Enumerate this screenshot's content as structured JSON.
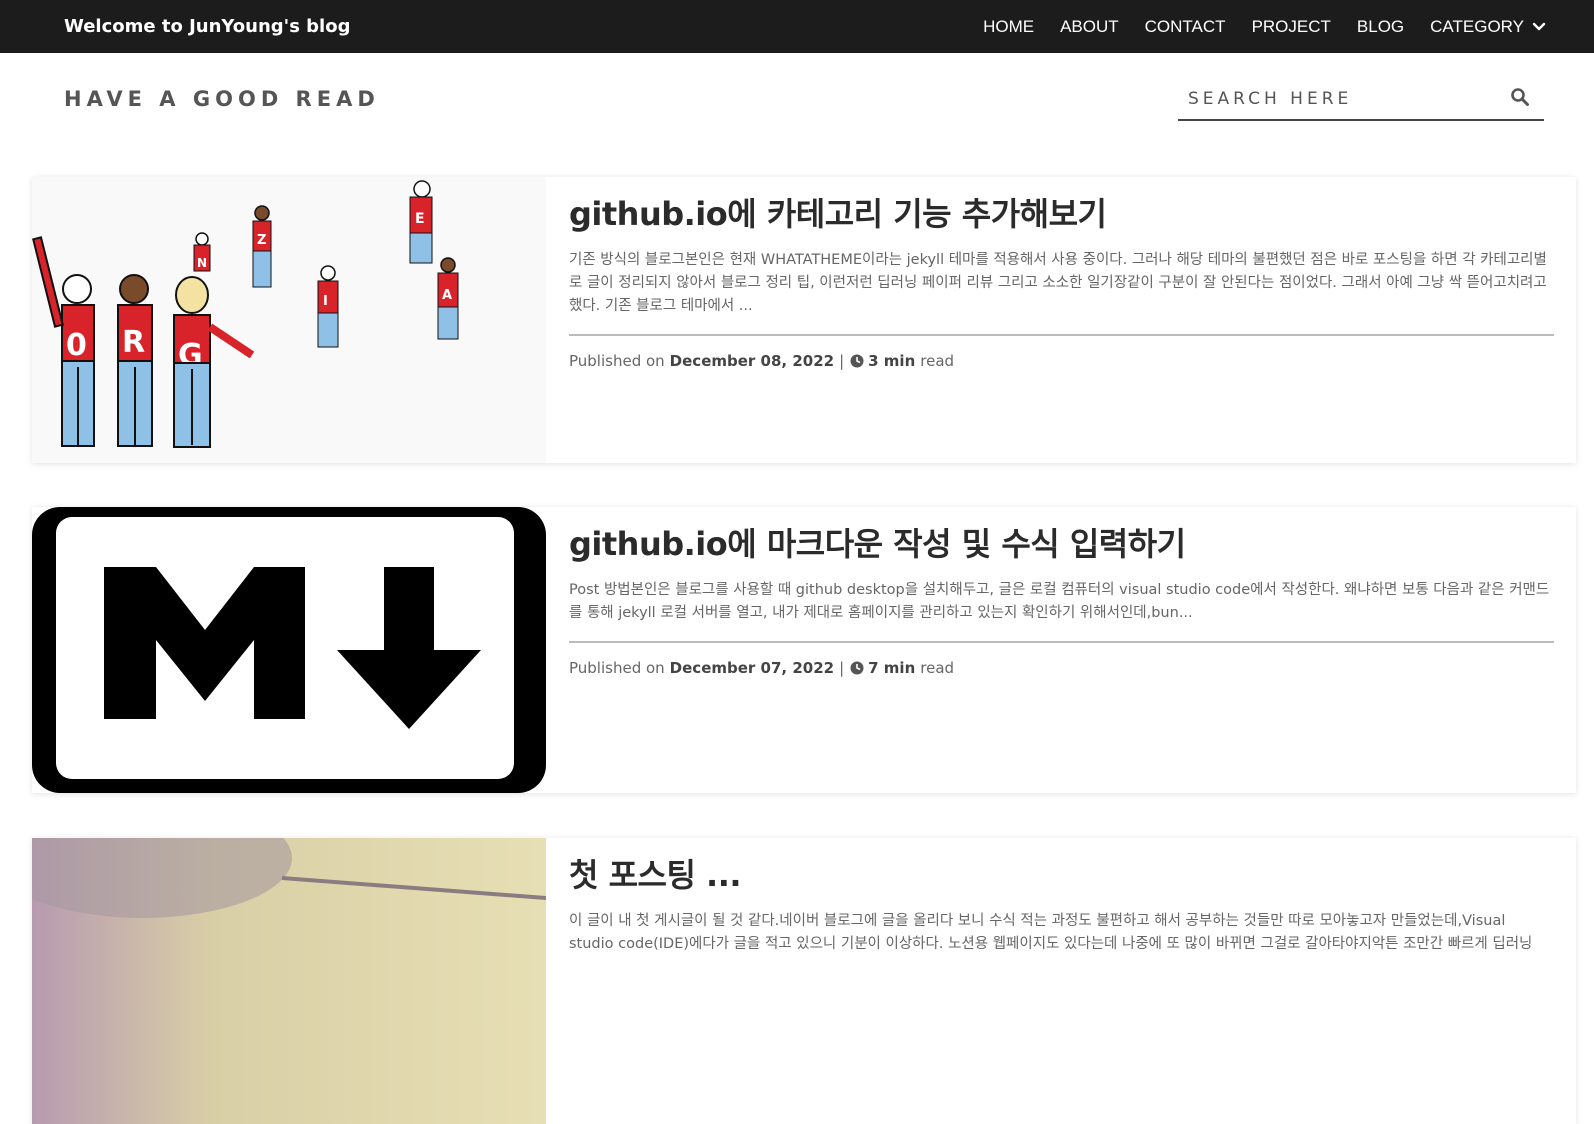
{
  "header": {
    "site_title": "Welcome to JunYoung's blog",
    "nav": [
      {
        "label": "HOME"
      },
      {
        "label": "ABOUT"
      },
      {
        "label": "CONTACT"
      },
      {
        "label": "PROJECT"
      },
      {
        "label": "BLOG"
      },
      {
        "label": "CATEGORY",
        "icon": "chevron-down-icon"
      }
    ]
  },
  "subheader": {
    "tagline": "HAVE A GOOD READ",
    "search": {
      "placeholder": "SEARCH HERE",
      "icon": "search-icon"
    }
  },
  "posts": [
    {
      "title": "github.io에 카테고리 기능 추가해보기",
      "excerpt": "기존 방식의 블로그본인은 현재 WHATATHEME이라는 jekyll 테마를 적용해서 사용 중이다. 그러나 해당 테마의 불편했던 점은 바로 포스팅을 하면 각 카테고리별로 글이 정리되지 않아서 블로그 정리 팁, 이런저런 딥러닝 페이퍼 리뷰 그리고 소소한 일기장같이 구분이 잘 안된다는 점이었다. 그래서 아예 그냥 싹 뜯어고치려고 했다. 기존 블로그 테마에서 ...",
      "published_label": "Published on",
      "date": "December 08, 2022",
      "separator": "|",
      "read_time": "3 min",
      "read_label": "read",
      "thumbnail": "org-people-illustration"
    },
    {
      "title": "github.io에 마크다운 작성 및 수식 입력하기",
      "excerpt": "Post 방법본인은 블로그를 사용할 때 github desktop을 설치해두고, 글은 로컬 컴퓨터의 visual studio code에서 작성한다. 왜냐하면 보통 다음과 같은 커맨드를 통해 jekyll 로컬 서버를 열고, 내가 제대로 홈페이지를 관리하고 있는지 확인하기 위해서인데,bun...",
      "published_label": "Published on",
      "date": "December 07, 2022",
      "separator": "|",
      "read_time": "7 min",
      "read_label": "read",
      "thumbnail": "markdown-logo"
    },
    {
      "title": "첫 포스팅 ...",
      "excerpt": "이 글이 내 첫 게시글이 될 것 같다.네이버 블로그에 글을 올리다 보니 수식 적는 과정도 불편하고 해서 공부하는 것들만 따로 모아놓고자 만들었는데,Visual studio code(IDE)에다가 글을 적고 있으니 기분이 이상하다. 노션용 웹페이지도 있다는데 나중에 또 많이 바뀌면 그걸로 갈아타야지악튼 조만간 빠르게 딥러닝",
      "thumbnail": "photo-thumbnail"
    }
  ],
  "colors": {
    "topbar_bg": "#1c1c1c",
    "title_text": "#2b2b2b",
    "body_text": "#666666"
  }
}
